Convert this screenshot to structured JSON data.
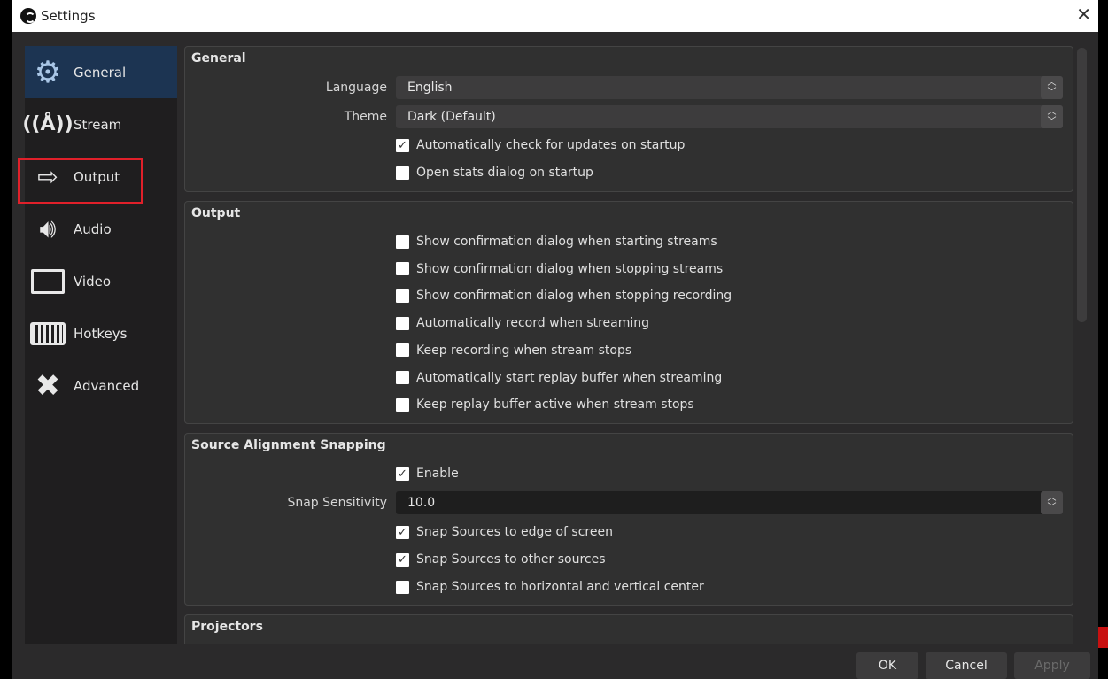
{
  "window": {
    "title": "Settings",
    "close_icon": "close-icon"
  },
  "sidebar": {
    "items": [
      {
        "label": "General",
        "icon": "gear-icon",
        "active": true
      },
      {
        "label": "Stream",
        "icon": "antenna-icon"
      },
      {
        "label": "Output",
        "icon": "monitor-arrow-icon",
        "highlighted": true
      },
      {
        "label": "Audio",
        "icon": "speaker-icon"
      },
      {
        "label": "Video",
        "icon": "monitor-icon"
      },
      {
        "label": "Hotkeys",
        "icon": "keyboard-icon"
      },
      {
        "label": "Advanced",
        "icon": "tools-icon"
      }
    ]
  },
  "general": {
    "title": "General",
    "language_label": "Language",
    "language_value": "English",
    "theme_label": "Theme",
    "theme_value": "Dark (Default)",
    "checks": [
      {
        "label": "Automatically check for updates on startup",
        "checked": true
      },
      {
        "label": "Open stats dialog on startup",
        "checked": false
      }
    ]
  },
  "output": {
    "title": "Output",
    "checks": [
      {
        "label": "Show confirmation dialog when starting streams",
        "checked": false
      },
      {
        "label": "Show confirmation dialog when stopping streams",
        "checked": false
      },
      {
        "label": "Show confirmation dialog when stopping recording",
        "checked": false
      },
      {
        "label": "Automatically record when streaming",
        "checked": false
      },
      {
        "label": "Keep recording when stream stops",
        "checked": false
      },
      {
        "label": "Automatically start replay buffer when streaming",
        "checked": false
      },
      {
        "label": "Keep replay buffer active when stream stops",
        "checked": false
      }
    ]
  },
  "snapping": {
    "title": "Source Alignment Snapping",
    "enable": {
      "label": "Enable",
      "checked": true
    },
    "sensitivity_label": "Snap Sensitivity",
    "sensitivity_value": "10.0",
    "checks": [
      {
        "label": "Snap Sources to edge of screen",
        "checked": true
      },
      {
        "label": "Snap Sources to other sources",
        "checked": true
      },
      {
        "label": "Snap Sources to horizontal and vertical center",
        "checked": false
      }
    ]
  },
  "projectors": {
    "title": "Projectors"
  },
  "buttons": {
    "ok": "OK",
    "cancel": "Cancel",
    "apply": "Apply"
  },
  "colors": {
    "accent": "#1c3452",
    "highlight": "#e0202a"
  }
}
